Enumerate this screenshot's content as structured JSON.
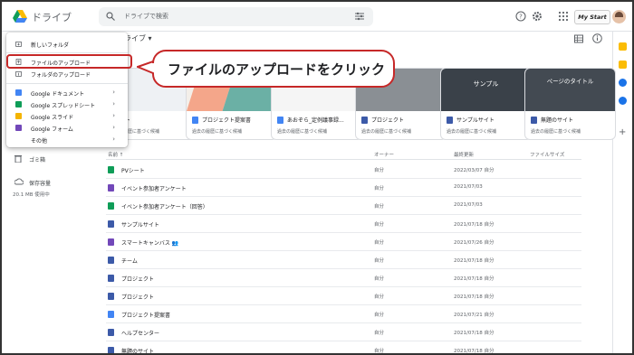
{
  "app": {
    "title": "ドライブ",
    "brand_button": "My Start"
  },
  "search": {
    "placeholder": "ドライブで検索"
  },
  "breadcrumb": {
    "label": "ライブ ▾"
  },
  "menu": {
    "items": [
      {
        "label": "新しいフォルダ",
        "icon": "folder-plus-icon"
      },
      {
        "label": "ファイルのアップロード",
        "icon": "file-upload-icon"
      },
      {
        "label": "フォルダのアップロード",
        "icon": "folder-upload-icon"
      },
      {
        "label": "Google ドキュメント",
        "icon": "docs-icon",
        "color": "#4285f4"
      },
      {
        "label": "Google スプレッドシート",
        "icon": "sheets-icon",
        "color": "#0f9d58"
      },
      {
        "label": "Google スライド",
        "icon": "slides-icon",
        "color": "#f4b400"
      },
      {
        "label": "Google フォーム",
        "icon": "forms-icon",
        "color": "#7248b9"
      },
      {
        "label": "その他",
        "icon": "none"
      }
    ]
  },
  "callout": {
    "text": "ファイルのアップロードをクリック",
    "color": "#c62828"
  },
  "nav": {
    "trash": "ゴミ箱",
    "storage": "保存容量",
    "usage": "20.1 MB 使用中"
  },
  "quick_access": [
    {
      "name": "ート",
      "sub": "過去の履歴に基づく候補",
      "color": "#4285f4"
    },
    {
      "name": "プロジェクト提案書",
      "sub": "過去の履歴に基づく候補",
      "color": "#4285f4"
    },
    {
      "name": "あおぞら_定例議事録...",
      "sub": "過去の履歴に基づく候補",
      "color": "#4285f4"
    },
    {
      "name": "プロジェクト",
      "sub": "過去の履歴に基づく候補",
      "color": "#3c5aa8"
    },
    {
      "name": "サンプルサイト",
      "sub": "過去の履歴に基づく候補",
      "color": "#3c5aa8",
      "thumb_text": "サンプル"
    },
    {
      "name": "無題のサイト",
      "sub": "過去の履歴に基づく候補",
      "color": "#3c5aa8",
      "thumb_text": "ページのタイトル"
    }
  ],
  "list": {
    "headers": {
      "name": "名前 ↑",
      "owner": "オーナー",
      "modified": "最終更新",
      "size": "ファイルサイズ"
    },
    "rows": [
      {
        "name": "PVシート",
        "owner": "自分",
        "modified": "2022/03/07 自分",
        "color": "#0f9d58"
      },
      {
        "name": "イベント参加者アンケート",
        "owner": "自分",
        "modified": "2021/07/03",
        "color": "#7248b9"
      },
      {
        "name": "イベント参加者アンケート（回答）",
        "owner": "自分",
        "modified": "2021/07/03",
        "color": "#0f9d58"
      },
      {
        "name": "サンプルサイト",
        "owner": "自分",
        "modified": "2021/07/18 自分",
        "color": "#3c5aa8"
      },
      {
        "name": "スマートキャンバス 👥",
        "owner": "自分",
        "modified": "2021/07/26 自分",
        "color": "#7248b9"
      },
      {
        "name": "チーム",
        "owner": "自分",
        "modified": "2021/07/18 自分",
        "color": "#3c5aa8"
      },
      {
        "name": "プロジェクト",
        "owner": "自分",
        "modified": "2021/07/18 自分",
        "color": "#3c5aa8"
      },
      {
        "name": "プロジェクト",
        "owner": "自分",
        "modified": "2021/07/18 自分",
        "color": "#3c5aa8"
      },
      {
        "name": "プロジェクト提案書",
        "owner": "自分",
        "modified": "2021/07/21 自分",
        "color": "#4285f4"
      },
      {
        "name": "ヘルプセンター",
        "owner": "自分",
        "modified": "2021/07/18 自分",
        "color": "#3c5aa8"
      },
      {
        "name": "無題のサイト",
        "owner": "自分",
        "modified": "2021/07/18 自分",
        "color": "#3c5aa8"
      }
    ]
  }
}
